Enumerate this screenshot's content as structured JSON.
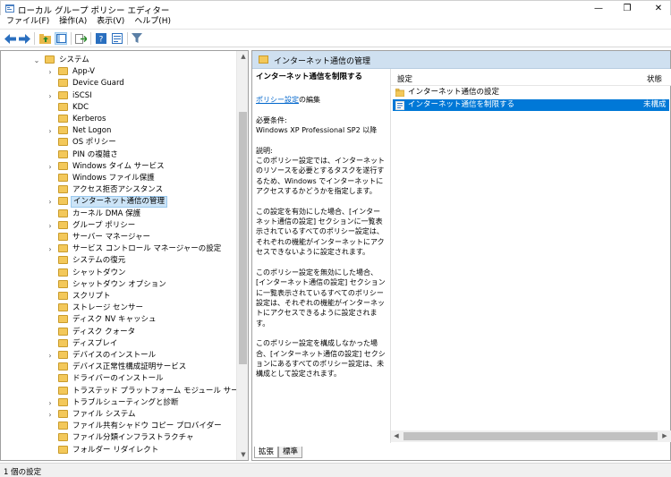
{
  "window": {
    "title": "ローカル グループ ポリシー エディター",
    "minimize_glyph": "—",
    "restore_glyph": "❐",
    "close_glyph": "✕"
  },
  "menu": [
    "ファイル(F)",
    "操作(A)",
    "表示(V)",
    "ヘルプ(H)"
  ],
  "toolbar": {
    "icons": [
      "back-arrow-icon",
      "forward-arrow-icon",
      "up-folder-icon",
      "show-hide-tree-icon",
      "export-list-icon",
      "help-icon",
      "properties-icon",
      "filter-icon"
    ]
  },
  "tree": {
    "root": {
      "label": "システム",
      "expanded": true
    },
    "items": [
      {
        "label": "App-V",
        "has_children": true
      },
      {
        "label": "Device Guard",
        "has_children": false
      },
      {
        "label": "iSCSI",
        "has_children": true
      },
      {
        "label": "KDC",
        "has_children": false
      },
      {
        "label": "Kerberos",
        "has_children": false
      },
      {
        "label": "Net Logon",
        "has_children": true
      },
      {
        "label": "OS ポリシー",
        "has_children": false
      },
      {
        "label": "PIN の複雑さ",
        "has_children": false
      },
      {
        "label": "Windows タイム サービス",
        "has_children": true
      },
      {
        "label": "Windows ファイル保護",
        "has_children": false
      },
      {
        "label": "アクセス拒否アシスタンス",
        "has_children": false
      },
      {
        "label": "インターネット通信の管理",
        "has_children": true,
        "selected": true
      },
      {
        "label": "カーネル DMA 保護",
        "has_children": false
      },
      {
        "label": "グループ ポリシー",
        "has_children": true
      },
      {
        "label": "サーバー マネージャー",
        "has_children": false
      },
      {
        "label": "サービス コントロール マネージャーの設定",
        "has_children": true
      },
      {
        "label": "システムの復元",
        "has_children": false
      },
      {
        "label": "シャットダウン",
        "has_children": false
      },
      {
        "label": "シャットダウン オプション",
        "has_children": false
      },
      {
        "label": "スクリプト",
        "has_children": false
      },
      {
        "label": "ストレージ センサー",
        "has_children": false
      },
      {
        "label": "ディスク NV キャッシュ",
        "has_children": false
      },
      {
        "label": "ディスク クォータ",
        "has_children": false
      },
      {
        "label": "ディスプレイ",
        "has_children": false
      },
      {
        "label": "デバイスのインストール",
        "has_children": true
      },
      {
        "label": "デバイス正常性構成証明サービス",
        "has_children": false
      },
      {
        "label": "ドライバーのインストール",
        "has_children": false
      },
      {
        "label": "トラステッド プラットフォーム モジュール サービス",
        "has_children": false
      },
      {
        "label": "トラブルシューティングと診断",
        "has_children": true
      },
      {
        "label": "ファイル システム",
        "has_children": true
      },
      {
        "label": "ファイル共有シャドウ コピー プロバイダー",
        "has_children": false
      },
      {
        "label": "ファイル分類インフラストラクチャ",
        "has_children": false
      },
      {
        "label": "フォルダー リダイレクト",
        "has_children": false
      }
    ]
  },
  "right": {
    "header": "インターネット通信の管理",
    "description": {
      "policy_name": "インターネット通信を制限する",
      "edit_link": "ポリシー設定",
      "edit_suffix": "の編集",
      "requirements_label": "必要条件:",
      "requirements_value": "Windows XP Professional SP2 以降",
      "explanation_label": "説明:",
      "p1": "このポリシー設定では、インターネットのリソースを必要とするタスクを遂行するため、Windows でインターネットにアクセスするかどうかを指定します。",
      "p2": "この設定を有効にした場合、[インターネット通信の設定] セクションに一覧表示されているすべてのポリシー設定は、それぞれの機能がインターネットにアクセスできないように設定されます。",
      "p3": "このポリシー設定を無効にした場合、[インターネット通信の設定] セクションに一覧表示されているすべてのポリシー設定は、それぞれの機能がインターネットにアクセスできるように設定されます。",
      "p4": "このポリシー設定を構成しなかった場合、[インターネット通信の設定] セクションにあるすべてのポリシー設定は、未構成として設定されます。"
    },
    "list": {
      "col_setting": "設定",
      "col_state": "状態",
      "rows": [
        {
          "name": "インターネット通信の設定",
          "state": "",
          "type": "folder"
        },
        {
          "name": "インターネット通信を制限する",
          "state": "未構成",
          "type": "policy",
          "selected": true
        }
      ]
    },
    "tabs": [
      "拡張",
      "標準"
    ],
    "active_tab": 0
  },
  "status": {
    "text": "1 個の設定"
  }
}
